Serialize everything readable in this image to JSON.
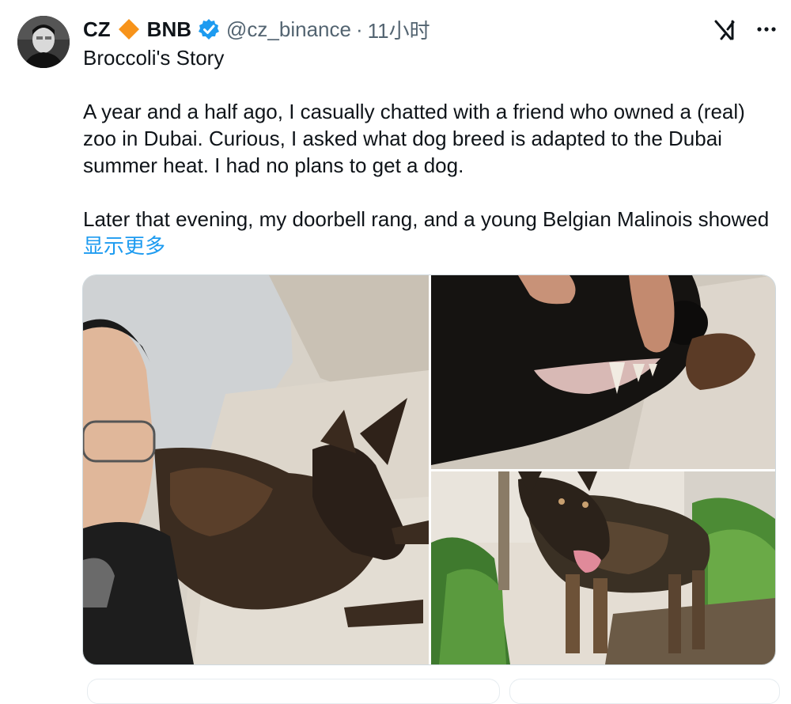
{
  "author": {
    "name": "CZ",
    "badge": "BNB",
    "handle": "@cz_binance",
    "separator": "·",
    "time": "11小时"
  },
  "tweet": {
    "title": "Broccoli's Story",
    "paragraph1": "A year and a half ago, I casually chatted with a friend who owned a (real) zoo in Dubai. Curious, I asked what dog breed is adapted to the Dubai summer heat. I had no plans to get a dog.",
    "paragraph2": "Later that evening, my doorbell rang, and a young Belgian Malinois showed",
    "show_more": "显示更多"
  },
  "icons": {
    "diamond": "bnb-diamond-icon",
    "verified": "verified-badge-icon",
    "grok": "grok-icon",
    "more": "more-icon"
  },
  "colors": {
    "link": "#1d9bf0",
    "verified": "#1d9bf0",
    "diamond": "#f7931a",
    "muted": "#536471"
  }
}
